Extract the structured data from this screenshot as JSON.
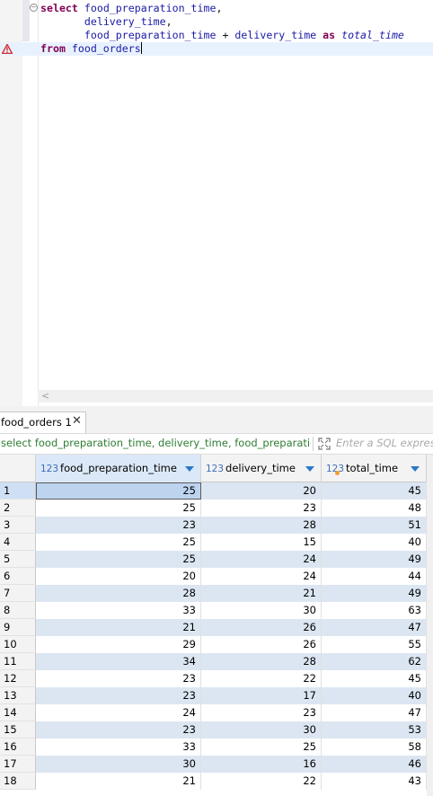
{
  "editor": {
    "line1": {
      "kw": "select",
      "col": "food_preparation_time",
      "tail": ","
    },
    "line2": {
      "col": "delivery_time",
      "tail": ","
    },
    "line3": {
      "col_a": "food_preparation_time",
      "op": " + ",
      "col_b": "delivery_time",
      "kw": "as",
      "alias": "total_time"
    },
    "line4": {
      "kw": "from",
      "table": "food_orders"
    }
  },
  "results": {
    "tab_label": "food_orders 1",
    "tab_close": "✕",
    "filter": {
      "query_text": "select food_preparation_time, delivery_time, food_preparation_time + delivery_time as total_time",
      "placeholder": "Enter a SQL expression to filter results"
    },
    "columns": [
      {
        "type": "123",
        "name": "food_preparation_time"
      },
      {
        "type": "123",
        "name": "delivery_time"
      },
      {
        "type": "123",
        "name": "total_time"
      }
    ],
    "rows": [
      [
        "1",
        "25",
        "20",
        "45"
      ],
      [
        "2",
        "25",
        "23",
        "48"
      ],
      [
        "3",
        "23",
        "28",
        "51"
      ],
      [
        "4",
        "25",
        "15",
        "40"
      ],
      [
        "5",
        "25",
        "24",
        "49"
      ],
      [
        "6",
        "20",
        "24",
        "44"
      ],
      [
        "7",
        "28",
        "21",
        "49"
      ],
      [
        "8",
        "33",
        "30",
        "63"
      ],
      [
        "9",
        "21",
        "26",
        "47"
      ],
      [
        "10",
        "29",
        "26",
        "55"
      ],
      [
        "11",
        "34",
        "28",
        "62"
      ],
      [
        "12",
        "23",
        "22",
        "45"
      ],
      [
        "13",
        "23",
        "17",
        "40"
      ],
      [
        "14",
        "24",
        "23",
        "47"
      ],
      [
        "15",
        "23",
        "30",
        "53"
      ],
      [
        "16",
        "33",
        "25",
        "58"
      ],
      [
        "17",
        "30",
        "16",
        "46"
      ],
      [
        "18",
        "21",
        "22",
        "43"
      ]
    ]
  },
  "colors": {
    "keyword": "#7f0055",
    "identifier": "#1a1aa6",
    "error": "#d32f2f",
    "filter_text": "#2e7d32",
    "alt_row": "#dce6f2"
  }
}
